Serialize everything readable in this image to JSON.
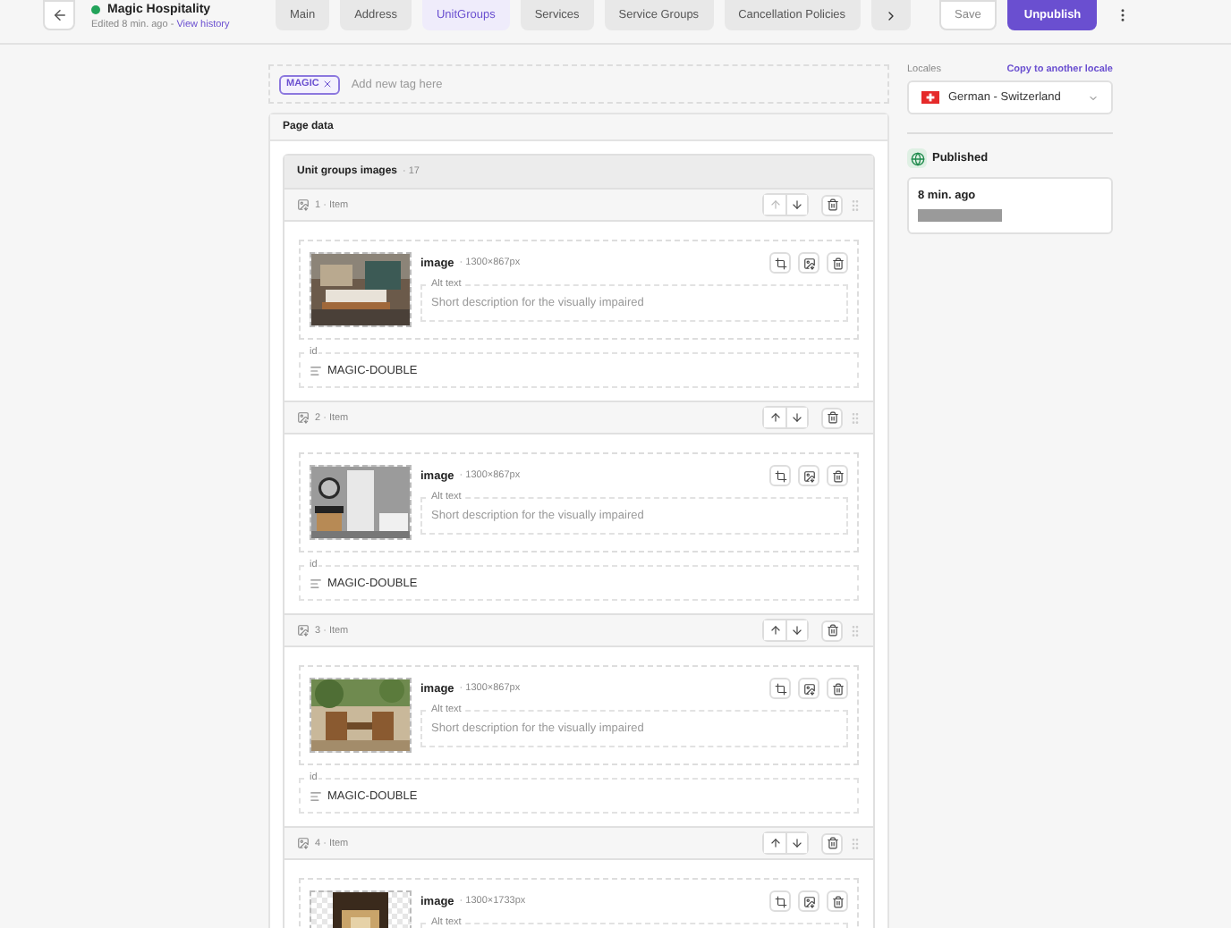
{
  "header": {
    "title": "Magic Hospitality",
    "edited": "Edited 8 min. ago -",
    "history_link": "View history",
    "tabs": [
      {
        "label": "Main",
        "selected": false
      },
      {
        "label": "Address",
        "selected": false
      },
      {
        "label": "UnitGroups",
        "selected": true
      },
      {
        "label": "Services",
        "selected": false
      },
      {
        "label": "Service Groups",
        "selected": false
      },
      {
        "label": "Cancellation Policies",
        "selected": false
      }
    ],
    "save": "Save",
    "unpublish": "Unpublish"
  },
  "tags": {
    "items": [
      "MAGIC"
    ],
    "placeholder": "Add new tag here"
  },
  "page_data": {
    "title": "Page data",
    "list_title": "Unit groups images",
    "count": "· 17",
    "items": [
      {
        "label": "1 · Item",
        "can_move_up": false,
        "image_label": "image",
        "size": "· 1300×867px",
        "alt_label": "Alt text",
        "alt_placeholder": "Short description for the visually impaired",
        "id_label": "id",
        "id_value": "MAGIC-DOUBLE"
      },
      {
        "label": "2 · Item",
        "can_move_up": true,
        "image_label": "image",
        "size": "· 1300×867px",
        "alt_label": "Alt text",
        "alt_placeholder": "Short description for the visually impaired",
        "id_label": "id",
        "id_value": "MAGIC-DOUBLE"
      },
      {
        "label": "3 · Item",
        "can_move_up": true,
        "image_label": "image",
        "size": "· 1300×867px",
        "alt_label": "Alt text",
        "alt_placeholder": "Short description for the visually impaired",
        "id_label": "id",
        "id_value": "MAGIC-DOUBLE"
      },
      {
        "label": "4 · Item",
        "can_move_up": true,
        "image_label": "image",
        "size": "· 1300×1733px",
        "alt_label": "Alt text"
      }
    ]
  },
  "sidebar": {
    "locales_label": "Locales",
    "copy_link": "Copy to another locale",
    "locale": "German - Switzerland",
    "status": "Published",
    "published_time": "8 min. ago"
  }
}
